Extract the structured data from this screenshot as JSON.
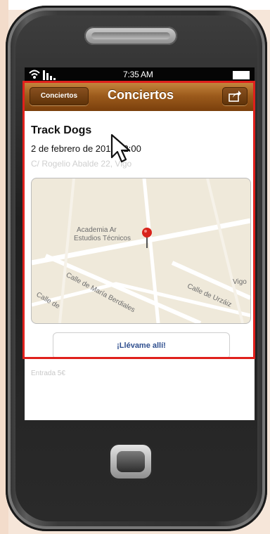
{
  "status_bar": {
    "time": "7:35 AM"
  },
  "nav": {
    "back_label": "Conciertos",
    "title": "Conciertos"
  },
  "event": {
    "title": "Track Dogs",
    "date": "2 de febrero de 2013 22:00",
    "address": "C/ Rogelio Abalde 22, Vigo"
  },
  "map": {
    "labels": {
      "academy_line1": "Academia Ar",
      "academy_line2": "Estudios Técnicos",
      "street_maria": "Calle de María Berdiales",
      "street_urzaiz": "Calle de Urzáiz",
      "street_bottom": "Calle de",
      "vigo": "Vigo"
    }
  },
  "directions_label": "¡Llévame allí!",
  "entry_label": "Entrada 5€",
  "colors": {
    "nav_brown": "#9c5b1c",
    "highlight_red": "#e0201c",
    "button_text": "#2f4f8f"
  }
}
